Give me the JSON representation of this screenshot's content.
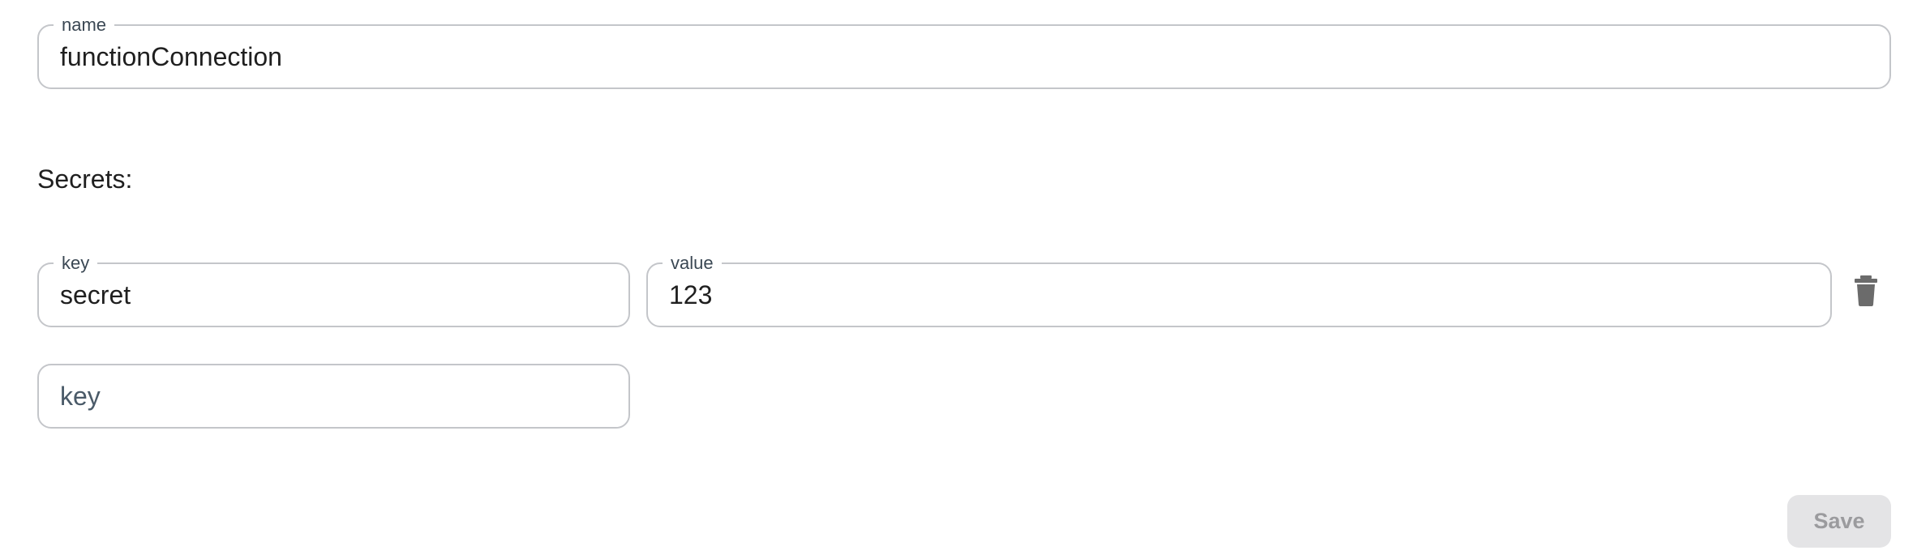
{
  "name_field": {
    "label": "name",
    "value": "functionConnection"
  },
  "secrets": {
    "heading": "Secrets:",
    "rows": [
      {
        "key_label": "key",
        "key_value": "secret",
        "value_label": "value",
        "value_value": "123"
      }
    ],
    "new_key_placeholder": "key"
  },
  "icons": {
    "delete": "trash-icon"
  },
  "colors": {
    "border": "#c4c6ca",
    "save_bg": "#e4e4e6",
    "save_text": "#9b9b9e",
    "trash": "#6b6b6b"
  },
  "actions": {
    "save_label": "Save"
  }
}
